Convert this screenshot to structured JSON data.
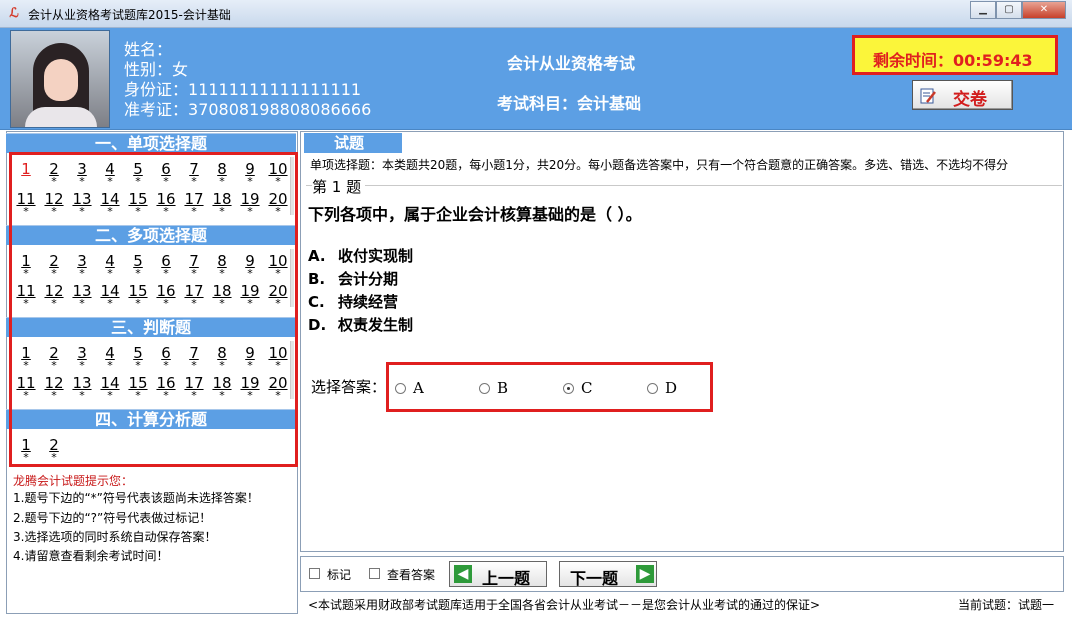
{
  "window": {
    "title": "会计从业资格考试题库2015-会计基础",
    "app_icon": "logo-icon",
    "minimize": "▁",
    "maximize": "▢",
    "close": "✕"
  },
  "candidate": {
    "name_label": "姓名：",
    "gender_label": "性别：",
    "gender": "女",
    "id_label": "身份证：",
    "id_value": "11111111111111111",
    "ticket_label": "准考证：",
    "ticket_value": "370808198808086666"
  },
  "exam": {
    "name": "会计从业资格考试",
    "subject": "考试科目：会计基础"
  },
  "timer": {
    "label": "剩余时间：",
    "value": "00:59:43"
  },
  "submit_label": "交卷",
  "sections": [
    {
      "title": "一、单项选择题",
      "rows": [
        [
          "1",
          "2",
          "3",
          "4",
          "5",
          "6",
          "7",
          "8",
          "9",
          "10"
        ],
        [
          "11",
          "12",
          "13",
          "14",
          "15",
          "16",
          "17",
          "18",
          "19",
          "20"
        ]
      ]
    },
    {
      "title": "二、多项选择题",
      "rows": [
        [
          "1",
          "2",
          "3",
          "4",
          "5",
          "6",
          "7",
          "8",
          "9",
          "10"
        ],
        [
          "11",
          "12",
          "13",
          "14",
          "15",
          "16",
          "17",
          "18",
          "19",
          "20"
        ]
      ]
    },
    {
      "title": "三、判断题",
      "rows": [
        [
          "1",
          "2",
          "3",
          "4",
          "5",
          "6",
          "7",
          "8",
          "9",
          "10"
        ],
        [
          "11",
          "12",
          "13",
          "14",
          "15",
          "16",
          "17",
          "18",
          "19",
          "20"
        ]
      ]
    },
    {
      "title": "四、计算分析题",
      "rows": [
        [
          "1",
          "2"
        ]
      ]
    }
  ],
  "unanswered_mark": "*",
  "tips": {
    "title": "龙腾会计试题提示您：",
    "items": [
      "1.题号下边的“*”符号代表该题尚未选择答案！",
      "2.题号下边的“?”符号代表做过标记！",
      "3.选择选项的同时系统自动保存答案！",
      "4.请留意查看剩余考试时间！"
    ]
  },
  "question_panel": {
    "tab": "试题",
    "type_desc": "单项选择题：本类题共20题，每小题1分，共20分。每小题备选答案中，只有一个符合题意的正确答案。多选、错选、不选均不得分",
    "number": "第 1 题",
    "text": "下列各项中，属于企业会计核算基础的是（ ）。",
    "options": [
      {
        "key": "A.",
        "text": "收付实现制"
      },
      {
        "key": "B.",
        "text": "会计分期"
      },
      {
        "key": "C.",
        "text": "持续经营"
      },
      {
        "key": "D.",
        "text": "权责发生制"
      }
    ],
    "answer_label": "选择答案：",
    "choices": [
      "A",
      "B",
      "C",
      "D"
    ],
    "selected": "C"
  },
  "controls": {
    "mark_label": "标记",
    "show_answer_label": "查看答案",
    "prev_label": "上一题",
    "next_label": "下一题"
  },
  "footer": {
    "notice": "<本试题采用财政部考试题库适用于全国各省会计从业考试－－是您会计从业考试的通过的保证>",
    "current": "当前试题：试题一"
  }
}
